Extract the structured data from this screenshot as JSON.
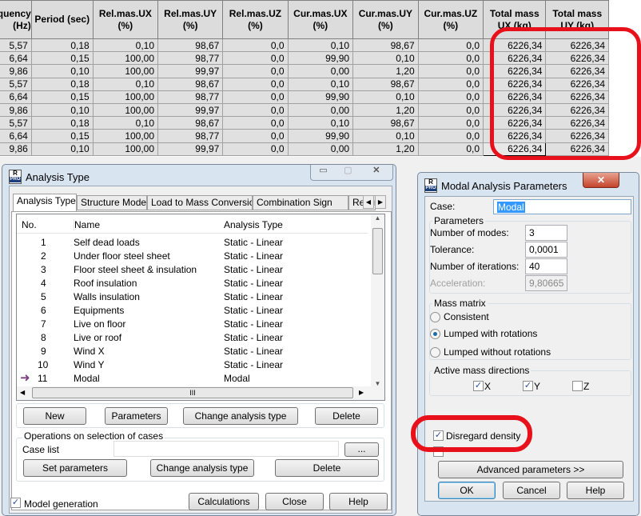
{
  "results_table": {
    "headers": [
      "Frequency (Hz)",
      "Period (sec)",
      "Rel.mas.UX (%)",
      "Rel.mas.UY (%)",
      "Rel.mas.UZ (%)",
      "Cur.mas.UX (%)",
      "Cur.mas.UY (%)",
      "Cur.mas.UZ (%)",
      "Total mass UX (kg)",
      "Total mass UY (kg)"
    ],
    "rows": [
      [
        "5,57",
        "0,18",
        "0,10",
        "98,67",
        "0,0",
        "0,10",
        "98,67",
        "0,0",
        "6226,34",
        "6226,34"
      ],
      [
        "6,64",
        "0,15",
        "100,00",
        "98,77",
        "0,0",
        "99,90",
        "0,10",
        "0,0",
        "6226,34",
        "6226,34"
      ],
      [
        "9,86",
        "0,10",
        "100,00",
        "99,97",
        "0,0",
        "0,00",
        "1,20",
        "0,0",
        "6226,34",
        "6226,34"
      ],
      [
        "5,57",
        "0,18",
        "0,10",
        "98,67",
        "0,0",
        "0,10",
        "98,67",
        "0,0",
        "6226,34",
        "6226,34"
      ],
      [
        "6,64",
        "0,15",
        "100,00",
        "98,77",
        "0,0",
        "99,90",
        "0,10",
        "0,0",
        "6226,34",
        "6226,34"
      ],
      [
        "9,86",
        "0,10",
        "100,00",
        "99,97",
        "0,0",
        "0,00",
        "1,20",
        "0,0",
        "6226,34",
        "6226,34"
      ],
      [
        "5,57",
        "0,18",
        "0,10",
        "98,67",
        "0,0",
        "0,10",
        "98,67",
        "0,0",
        "6226,34",
        "6226,34"
      ],
      [
        "6,64",
        "0,15",
        "100,00",
        "98,77",
        "0,0",
        "99,90",
        "0,10",
        "0,0",
        "6226,34",
        "6226,34"
      ],
      [
        "9,86",
        "0,10",
        "100,00",
        "99,97",
        "0,0",
        "0,00",
        "1,20",
        "0,0",
        "6226,34",
        "6226,34"
      ]
    ]
  },
  "analysis_window": {
    "title": "Analysis Type",
    "logo": "R PRO",
    "tabs": [
      "Analysis Types",
      "Structure Model",
      "Load to Mass Conversion",
      "Combination Sign",
      "Result F"
    ],
    "columns": [
      "No.",
      "Name",
      "Analysis Type"
    ],
    "cases": [
      {
        "no": "1",
        "name": "Self dead loads",
        "type": "Static - Linear"
      },
      {
        "no": "2",
        "name": "Under floor steel sheet",
        "type": "Static - Linear"
      },
      {
        "no": "3",
        "name": "Floor steel sheet & insulation",
        "type": "Static - Linear"
      },
      {
        "no": "4",
        "name": "Roof insulation",
        "type": "Static - Linear"
      },
      {
        "no": "5",
        "name": "Walls insulation",
        "type": "Static - Linear"
      },
      {
        "no": "6",
        "name": "Equipments",
        "type": "Static - Linear"
      },
      {
        "no": "7",
        "name": "Live on floor",
        "type": "Static - Linear"
      },
      {
        "no": "8",
        "name": "Live or roof",
        "type": "Static - Linear"
      },
      {
        "no": "9",
        "name": "Wind X",
        "type": "Static - Linear"
      },
      {
        "no": "10",
        "name": "Wind Y",
        "type": "Static - Linear"
      },
      {
        "no": "11",
        "name": "Modal",
        "type": "Modal",
        "current": true
      }
    ],
    "buttons": {
      "new": "New",
      "parameters": "Parameters",
      "change": "Change analysis type",
      "delete": "Delete"
    },
    "operations": {
      "title": "Operations on selection of cases",
      "case_list_label": "Case list",
      "case_list_value": "",
      "browse": "...",
      "set_parameters": "Set parameters",
      "change": "Change analysis type",
      "delete": "Delete"
    },
    "model_generation": {
      "label": "Model generation",
      "checked": true
    },
    "footer": {
      "calculations": "Calculations",
      "close": "Close",
      "help": "Help"
    }
  },
  "modal_window": {
    "title": "Modal Analysis Parameters",
    "case_label": "Case:",
    "case_value": "Modal",
    "parameters_title": "Parameters",
    "modes_label": "Number of modes:",
    "modes_value": "3",
    "tolerance_label": "Tolerance:",
    "tolerance_value": "0,0001",
    "iterations_label": "Number of iterations:",
    "iterations_value": "40",
    "acceleration_label": "Acceleration:",
    "acceleration_value": "9,80665",
    "mass_matrix_title": "Mass matrix",
    "mass_options": [
      "Consistent",
      "Lumped with rotations",
      "Lumped without rotations"
    ],
    "mass_selected": "Lumped with rotations",
    "directions_title": "Active mass directions",
    "directions": [
      {
        "label": "X",
        "checked": true
      },
      {
        "label": "Y",
        "checked": true
      },
      {
        "label": "Z",
        "checked": false
      }
    ],
    "disregard_density": {
      "label": "Disregard density",
      "checked": true
    },
    "advanced": "Advanced parameters >>",
    "ok": "OK",
    "cancel": "Cancel",
    "help": "Help",
    "close_icon": "close-icon"
  },
  "highlight_color": "#e8101a"
}
